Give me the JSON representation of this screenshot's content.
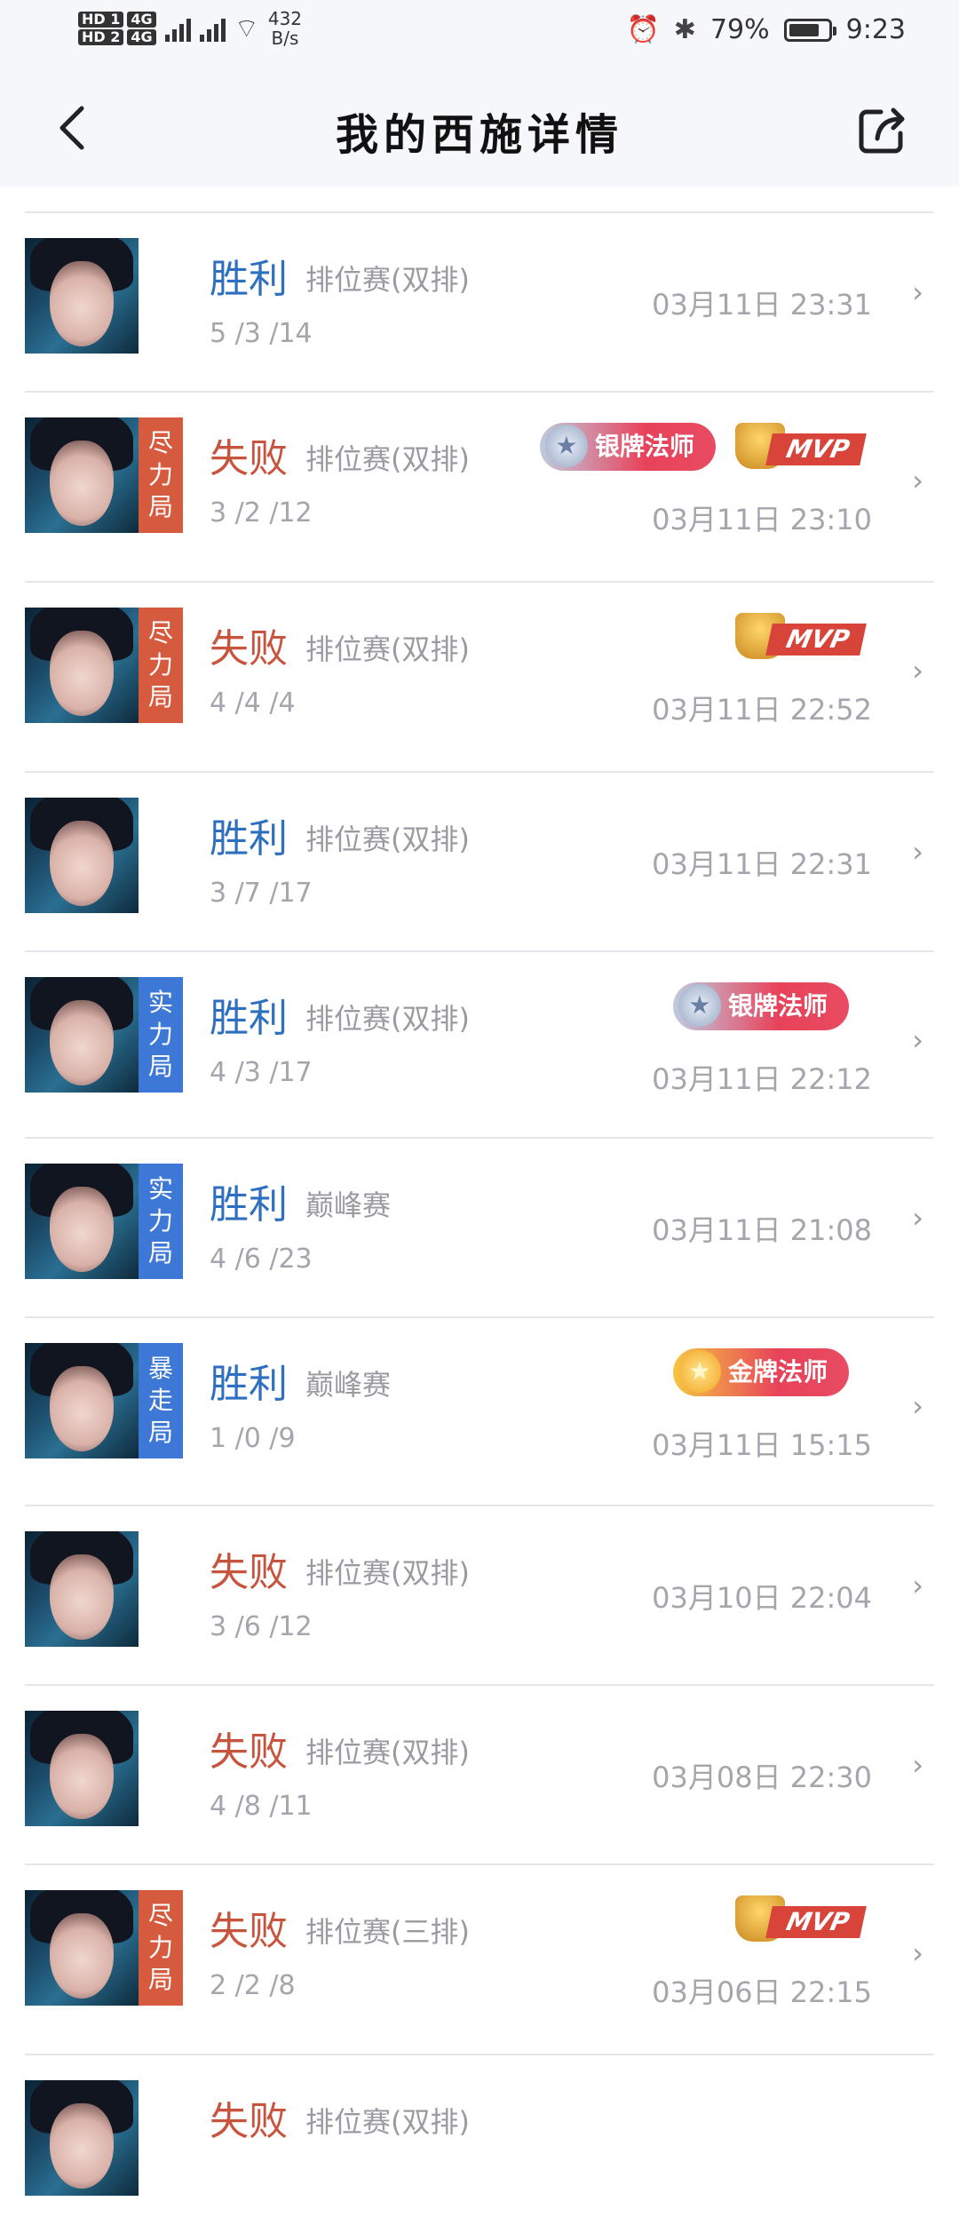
{
  "status_bar": {
    "hd1": "HD 1",
    "hd2": "HD 2",
    "net1": "4G",
    "net2": "4G",
    "speed_value": "432",
    "speed_unit": "B/s",
    "battery_percent": "79%",
    "battery_level": 0.79,
    "time": "9:23"
  },
  "header": {
    "title": "我的西施详情"
  },
  "matches": [
    {
      "result": "胜利",
      "outcome": "win",
      "mode": "排位赛(双排)",
      "kda": "5 /3 /14",
      "time": "03月11日 23:31",
      "tag": null,
      "badge": null,
      "mvp": false
    },
    {
      "result": "失败",
      "outcome": "lose",
      "mode": "排位赛(双排)",
      "kda": "3 /2 /12",
      "time": "03月11日 23:10",
      "tag": {
        "text": [
          "尽",
          "力",
          "局"
        ],
        "color": "red"
      },
      "badge": {
        "type": "silver",
        "label": "银牌法师"
      },
      "mvp": true
    },
    {
      "result": "失败",
      "outcome": "lose",
      "mode": "排位赛(双排)",
      "kda": "4 /4 /4",
      "time": "03月11日 22:52",
      "tag": {
        "text": [
          "尽",
          "力",
          "局"
        ],
        "color": "red"
      },
      "badge": null,
      "mvp": true
    },
    {
      "result": "胜利",
      "outcome": "win",
      "mode": "排位赛(双排)",
      "kda": "3 /7 /17",
      "time": "03月11日 22:31",
      "tag": null,
      "badge": null,
      "mvp": false
    },
    {
      "result": "胜利",
      "outcome": "win",
      "mode": "排位赛(双排)",
      "kda": "4 /3 /17",
      "time": "03月11日 22:12",
      "tag": {
        "text": [
          "实",
          "力",
          "局"
        ],
        "color": "blue"
      },
      "badge": {
        "type": "silver",
        "label": "银牌法师"
      },
      "mvp": false
    },
    {
      "result": "胜利",
      "outcome": "win",
      "mode": "巅峰赛",
      "kda": "4 /6 /23",
      "time": "03月11日 21:08",
      "tag": {
        "text": [
          "实",
          "力",
          "局"
        ],
        "color": "blue"
      },
      "badge": null,
      "mvp": false
    },
    {
      "result": "胜利",
      "outcome": "win",
      "mode": "巅峰赛",
      "kda": "1 /0 /9",
      "time": "03月11日 15:15",
      "tag": {
        "text": [
          "暴",
          "走",
          "局"
        ],
        "color": "blue"
      },
      "badge": {
        "type": "gold",
        "label": "金牌法师"
      },
      "mvp": false
    },
    {
      "result": "失败",
      "outcome": "lose",
      "mode": "排位赛(双排)",
      "kda": "3 /6 /12",
      "time": "03月10日 22:04",
      "tag": null,
      "badge": null,
      "mvp": false
    },
    {
      "result": "失败",
      "outcome": "lose",
      "mode": "排位赛(双排)",
      "kda": "4 /8 /11",
      "time": "03月08日 22:30",
      "tag": null,
      "badge": null,
      "mvp": false
    },
    {
      "result": "失败",
      "outcome": "lose",
      "mode": "排位赛(三排)",
      "kda": "2 /2 /8",
      "time": "03月06日 22:15",
      "tag": {
        "text": [
          "尽",
          "力",
          "局"
        ],
        "color": "red"
      },
      "badge": null,
      "mvp": true
    },
    {
      "result": "失败",
      "outcome": "lose",
      "mode": "排位赛(双排)",
      "kda": "",
      "time": "",
      "tag": null,
      "badge": null,
      "mvp": false
    }
  ],
  "mvp_label": "MVP",
  "arrow_glyph": "›"
}
